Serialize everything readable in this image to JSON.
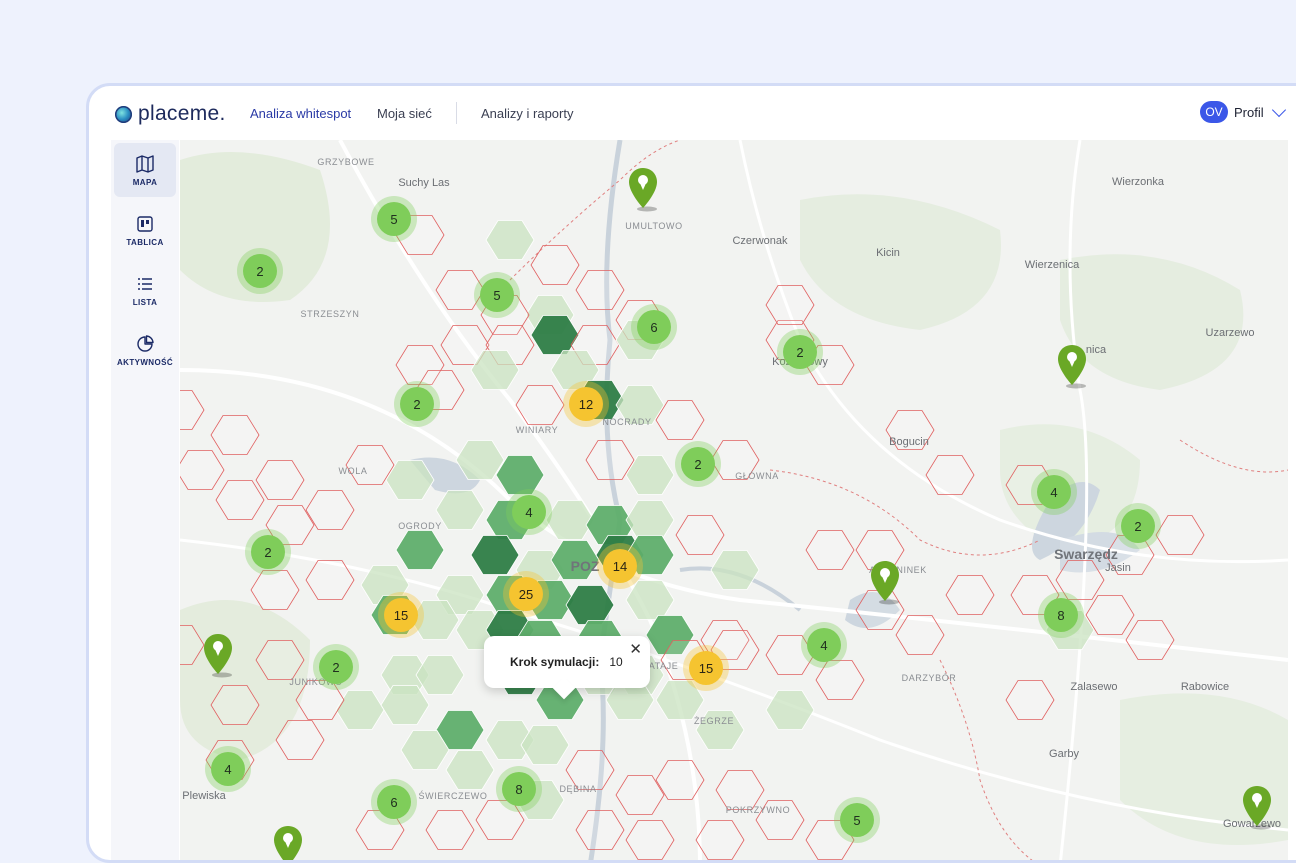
{
  "app": {
    "logo_text": "placeme.",
    "nav": [
      {
        "label": "Analiza whitespot",
        "active": true
      },
      {
        "label": "Moja sieć",
        "active": false
      },
      {
        "label": "Analizy i raporty",
        "active": false
      }
    ],
    "profile": {
      "initials": "OV",
      "label": "Profil"
    }
  },
  "sidebar": {
    "items": [
      {
        "label": "MAPA",
        "icon": "map-icon",
        "active": true
      },
      {
        "label": "TABLICA",
        "icon": "board-icon",
        "active": false
      },
      {
        "label": "LISTA",
        "icon": "list-icon",
        "active": false
      },
      {
        "label": "AKTYWNOŚĆ",
        "icon": "pie-chart-icon",
        "active": false
      }
    ]
  },
  "map": {
    "places": [
      {
        "name": "GRZYBOWE",
        "style": "small"
      },
      {
        "name": "Suchy Las",
        "style": "normal"
      },
      {
        "name": "UMULTOWO",
        "style": "small"
      },
      {
        "name": "Czerwonak",
        "style": "normal"
      },
      {
        "name": "Kicin",
        "style": "normal"
      },
      {
        "name": "Wierzonka",
        "style": "normal"
      },
      {
        "name": "Wierzenica",
        "style": "normal"
      },
      {
        "name": "Uzarzewo",
        "style": "normal"
      },
      {
        "name": "STRZESZYN",
        "style": "small"
      },
      {
        "name": "Koziegłowy",
        "style": "normal"
      },
      {
        "name": "nica",
        "style": "normal"
      },
      {
        "name": "WINIARY",
        "style": "small"
      },
      {
        "name": "NOCRADY",
        "style": "small"
      },
      {
        "name": "Bogucin",
        "style": "normal"
      },
      {
        "name": "WOLA",
        "style": "small"
      },
      {
        "name": "GŁÓWNA",
        "style": "small"
      },
      {
        "name": "OGRODY",
        "style": "small"
      },
      {
        "name": "Swarzędz",
        "style": "big"
      },
      {
        "name": "Jasin",
        "style": "normal"
      },
      {
        "name": "POZ",
        "style": "big"
      },
      {
        "name": "ANTONINEK",
        "style": "small"
      },
      {
        "name": "JUNIKOWO",
        "style": "small"
      },
      {
        "name": "RATAJE",
        "style": "small"
      },
      {
        "name": "DARZYBÓR",
        "style": "small"
      },
      {
        "name": "Zalasewo",
        "style": "normal"
      },
      {
        "name": "Rabowice",
        "style": "normal"
      },
      {
        "name": "ŻEGRZE",
        "style": "small"
      },
      {
        "name": "Garby",
        "style": "normal"
      },
      {
        "name": "Plewiska",
        "style": "normal"
      },
      {
        "name": "ŚWIERCZEWO",
        "style": "small"
      },
      {
        "name": "DĘBINA",
        "style": "small"
      },
      {
        "name": "POKRZYWNO",
        "style": "small"
      },
      {
        "name": "Gowarzewo",
        "style": "normal"
      }
    ],
    "clusters": [
      {
        "count": "5",
        "color": "green"
      },
      {
        "count": "2",
        "color": "green"
      },
      {
        "count": "5",
        "color": "green"
      },
      {
        "count": "6",
        "color": "green"
      },
      {
        "count": "2",
        "color": "green"
      },
      {
        "count": "2",
        "color": "green"
      },
      {
        "count": "12",
        "color": "yellow"
      },
      {
        "count": "2",
        "color": "green"
      },
      {
        "count": "4",
        "color": "green"
      },
      {
        "count": "4",
        "color": "green"
      },
      {
        "count": "2",
        "color": "green"
      },
      {
        "count": "2",
        "color": "green"
      },
      {
        "count": "14",
        "color": "yellow"
      },
      {
        "count": "25",
        "color": "yellow"
      },
      {
        "count": "15",
        "color": "yellow"
      },
      {
        "count": "8",
        "color": "green"
      },
      {
        "count": "4",
        "color": "green"
      },
      {
        "count": "2",
        "color": "green"
      },
      {
        "count": "15",
        "color": "yellow"
      },
      {
        "count": "4",
        "color": "green"
      },
      {
        "count": "6",
        "color": "green"
      },
      {
        "count": "8",
        "color": "green"
      },
      {
        "count": "5",
        "color": "green"
      }
    ],
    "popup": {
      "label": "Krok symulacji:",
      "value": "10"
    },
    "colors": {
      "hex_empty_stroke": "#e06060",
      "hex_light": "#c9e3c0",
      "hex_mid": "#5fae6c",
      "hex_dark": "#2e7d46",
      "pin": "#6aa826"
    }
  }
}
